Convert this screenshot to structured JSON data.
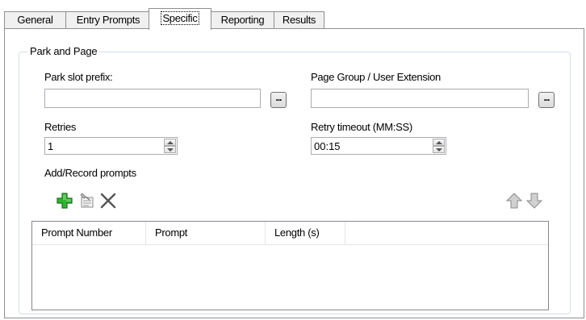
{
  "tabs": [
    {
      "label": "General",
      "active": false
    },
    {
      "label": "Entry Prompts",
      "active": false
    },
    {
      "label": "Specific",
      "active": true
    },
    {
      "label": "Reporting",
      "active": false
    },
    {
      "label": "Results",
      "active": false
    }
  ],
  "group": {
    "title": "Park and Page",
    "park_slot_prefix": {
      "label": "Park slot prefix:",
      "value": "",
      "browse_label": "..."
    },
    "page_group": {
      "label": "Page Group / User Extension",
      "value": "",
      "browse_label": "..."
    },
    "retries": {
      "label": "Retries",
      "value": "1"
    },
    "retry_timeout": {
      "label": "Retry timeout (MM:SS)",
      "value": "00:15"
    },
    "prompts": {
      "label": "Add/Record prompts",
      "toolbar_icons": [
        "add-icon",
        "edit-prompt-icon",
        "delete-icon",
        "move-up-icon",
        "move-down-icon"
      ],
      "columns": [
        "Prompt Number",
        "Prompt",
        "Length (s)"
      ],
      "rows": []
    }
  },
  "colors": {
    "tab_border": "#8e8f8f",
    "add_green": "#2fb52f",
    "arrow_gray": "#a8a8a8"
  }
}
